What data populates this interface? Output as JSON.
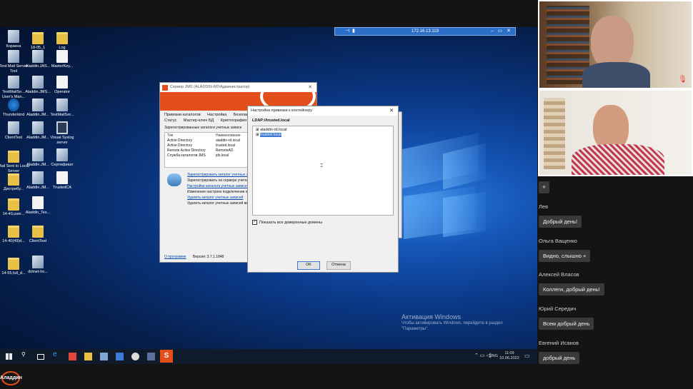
{
  "remote_bar": {
    "address": "172.16.13.119"
  },
  "desktop_icons": [
    {
      "label": "Корзина",
      "kind": "app"
    },
    {
      "label": "18-05_1",
      "kind": "folder"
    },
    {
      "label": "Log",
      "kind": "folder"
    },
    {
      "label": "Test Mail Server Tool",
      "kind": "app"
    },
    {
      "label": "Aladdin.JAS...",
      "kind": "app"
    },
    {
      "label": "MasterKey...",
      "kind": "doc"
    },
    {
      "label": "TestMailSe... User's Man...",
      "kind": "app"
    },
    {
      "label": "Aladdin.JMS...",
      "kind": "app"
    },
    {
      "label": "Operator",
      "kind": "doc"
    },
    {
      "label": "Thunderkind",
      "kind": "globe"
    },
    {
      "label": "Aladdin.JM...",
      "kind": "app"
    },
    {
      "label": "TestMailSer...",
      "kind": "app"
    },
    {
      "label": "ClientTest",
      "kind": "app"
    },
    {
      "label": "Aladdin.JM...",
      "kind": "app"
    },
    {
      "label": "Visual Syslog server",
      "kind": "mon"
    },
    {
      "label": "Mail Sent to Local Server",
      "kind": "folder"
    },
    {
      "label": "Aladdin.JM...",
      "kind": "app"
    },
    {
      "label": "Сертификат",
      "kind": "app"
    },
    {
      "label": "Дистрибу...",
      "kind": "folder"
    },
    {
      "label": "Aladdin.JM...",
      "kind": "app"
    },
    {
      "label": "TrustedCA",
      "kind": "doc"
    },
    {
      "label": "14-40,user...",
      "kind": "folder"
    },
    {
      "label": "Aladdin_Tes...",
      "kind": "doc"
    },
    {
      "label": "14-40(49)d...",
      "kind": "folder"
    },
    {
      "label": "ClientTest",
      "kind": "folder"
    },
    {
      "label": "14-55,full_d...",
      "kind": "folder"
    },
    {
      "label": "dotnet-ho...",
      "kind": "app"
    }
  ],
  "server_window": {
    "title": "Сервер JMS (ALADDIN-RD\\Администратор)",
    "tabs_row1": [
      "Привязки каталогов",
      "Настройка",
      "Безопас"
    ],
    "tabs_row2": [
      "Статус",
      "Мастер-ключ БД",
      "Криптография"
    ],
    "section_label": "Зарегистрированные каталоги учетных записе",
    "columns": [
      "Тип",
      "Наименование"
    ],
    "rows": [
      [
        "Active Directory",
        "aladdin-rd.local"
      ],
      [
        "Active Directory",
        "trusted.local"
      ],
      [
        "Remote Active Directory",
        "RemoteAD"
      ],
      [
        "Служба каталогов JMS",
        "jds.local"
      ]
    ],
    "actions": [
      {
        "label": "Зарегистрировать каталог учетных за",
        "link": true
      },
      {
        "label": "Зарегистрировать на сервере учетные",
        "link": false
      },
      {
        "label": "Настройки каталога учетных записей",
        "link": true
      },
      {
        "label": "Изменение настроек подключения к ",
        "link": false
      },
      {
        "label": "Удалить каталог учетных записей",
        "link": true
      },
      {
        "label": "Удалить каталог учетных записей вм",
        "link": false
      }
    ],
    "about_link": "О программе",
    "version": "Версия: 3.7.1.1848"
  },
  "dialog": {
    "title": "Настройка привязки к контейнеру",
    "path": "LDAP://trusted.local",
    "tree": [
      "aladdin-rd.local",
      "trusted.local"
    ],
    "checkbox_label": "Показать все доверенные домены",
    "ok": "OK",
    "cancel": "Отмена"
  },
  "activation": {
    "title": "Активация Windows",
    "text": "Чтобы активировать Windows, перейдите в раздел \"Параметры\"."
  },
  "taskbar": {
    "lang": "ENG",
    "time": "11:09",
    "date": "10.06.2022"
  },
  "chat": {
    "add_button": "+",
    "messages": [
      {
        "name": "Лев",
        "text": "Добрый день!"
      },
      {
        "name": "Ольга Ващенко",
        "text": "Видно, слышно +"
      },
      {
        "name": "Алексей Власов",
        "text": "Коллеги, добрый день!"
      },
      {
        "name": "Юрий Середич",
        "text": "Всем добрый день"
      },
      {
        "name": "Евгений Исанов",
        "text": "добрый день"
      }
    ]
  },
  "logo": "Аладдин"
}
